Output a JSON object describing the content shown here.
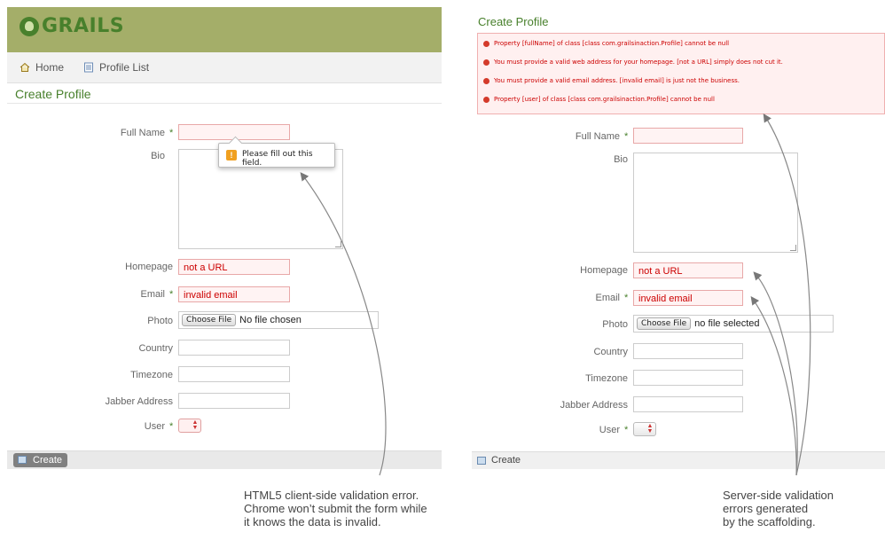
{
  "left": {
    "logo": "GRAILS",
    "nav": {
      "home": "Home",
      "profile_list": "Profile List"
    },
    "title": "Create Profile",
    "fields": {
      "full_name": {
        "label": "Full Name",
        "req": "*",
        "value": ""
      },
      "bio": {
        "label": "Bio"
      },
      "homepage": {
        "label": "Homepage",
        "value": "not a URL"
      },
      "email": {
        "label": "Email",
        "req": "*",
        "value": "invalid email"
      },
      "photo": {
        "label": "Photo",
        "button": "Choose File",
        "status": "No file chosen"
      },
      "country": {
        "label": "Country",
        "value": ""
      },
      "timezone": {
        "label": "Timezone",
        "value": ""
      },
      "jabber": {
        "label": "Jabber Address",
        "value": ""
      },
      "user": {
        "label": "User",
        "req": "*"
      }
    },
    "tooltip": {
      "icon": "!",
      "text": "Please fill out this field."
    },
    "create_button": "Create"
  },
  "right": {
    "title": "Create Profile",
    "errors": [
      "Property [fullName] of class [class com.grailsinaction.Profile] cannot be null",
      "You must provide a valid web address for your homepage. [not a URL] simply does not cut it.",
      "You must provide a valid email address. [invalid email] is just not the business.",
      "Property [user] of class [class com.grailsinaction.Profile] cannot be null"
    ],
    "fields": {
      "full_name": {
        "label": "Full Name",
        "req": "*",
        "value": ""
      },
      "bio": {
        "label": "Bio"
      },
      "homepage": {
        "label": "Homepage",
        "value": "not a URL"
      },
      "email": {
        "label": "Email",
        "req": "*",
        "value": "invalid email"
      },
      "photo": {
        "label": "Photo",
        "button": "Choose File",
        "status": "no file selected"
      },
      "country": {
        "label": "Country",
        "value": ""
      },
      "timezone": {
        "label": "Timezone",
        "value": ""
      },
      "jabber": {
        "label": "Jabber Address",
        "value": ""
      },
      "user": {
        "label": "User",
        "req": "*"
      }
    },
    "create_button": "Create"
  },
  "captions": {
    "client": [
      "HTML5 client-side validation error.",
      "Chrome won’t submit the form while",
      "it knows the data is invalid."
    ],
    "server": [
      "Server-side validation",
      "errors generated",
      "by the scaffolding."
    ]
  },
  "icons": {
    "logo": "grails-logo-icon",
    "home": "home-icon",
    "list": "list-icon",
    "warning": "warning-icon",
    "error": "error-icon",
    "create": "create-icon"
  },
  "colors": {
    "brand_green": "#48802c",
    "header_olive": "#a4ae69",
    "error_red": "#cc0000",
    "error_bg": "#fff0f0"
  }
}
